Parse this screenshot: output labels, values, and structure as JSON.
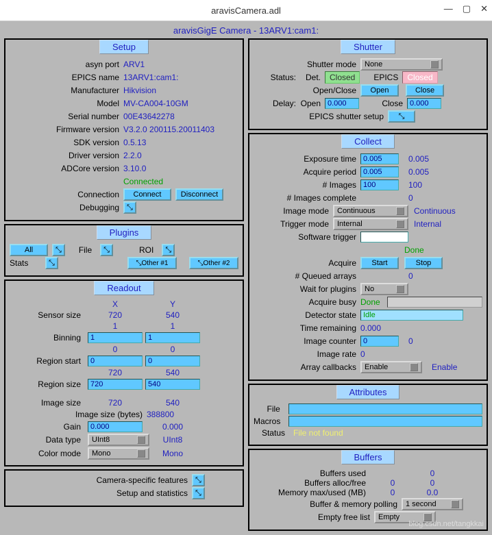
{
  "window": {
    "title": "aravisCamera.adl"
  },
  "subtitle": "aravisGigE Camera - 13ARV1:cam1:",
  "setup": {
    "title": "Setup",
    "asyn_port_lbl": "asyn port",
    "asyn_port": "ARV1",
    "epics_name_lbl": "EPICS name",
    "epics_name": "13ARV1:cam1:",
    "manufacturer_lbl": "Manufacturer",
    "manufacturer": "Hikvision",
    "model_lbl": "Model",
    "model": "MV-CA004-10GM",
    "serial_lbl": "Serial number",
    "serial": "00E43642278",
    "firmware_lbl": "Firmware version",
    "firmware": "V3.2.0 200115.20011403",
    "sdk_lbl": "SDK version",
    "sdk": "0.5.13",
    "driver_lbl": "Driver version",
    "driver": "2.2.0",
    "adcore_lbl": "ADCore version",
    "adcore": "3.10.0",
    "connected": "Connected",
    "connection_lbl": "Connection",
    "connect": "Connect",
    "disconnect": "Disconnect",
    "debugging_lbl": "Debugging",
    "debug_btn": "⤡"
  },
  "plugins": {
    "title": "Plugins",
    "all": "All",
    "all_btn": "⤡",
    "file": "File",
    "file_btn": "⤡",
    "roi": "ROI",
    "roi_btn": "⤡",
    "stats": "Stats",
    "stats_btn": "⤡",
    "other1": "⤡Other #1",
    "other2": "⤡Other #2"
  },
  "readout": {
    "title": "Readout",
    "x_hdr": "X",
    "y_hdr": "Y",
    "sensor_lbl": "Sensor size",
    "sensor_x": "720",
    "sensor_y": "540",
    "one_x": "1",
    "one_y": "1",
    "binning_lbl": "Binning",
    "bin_x": "1",
    "bin_y": "1",
    "zero_x": "0",
    "zero_y": "0",
    "region_start_lbl": "Region start",
    "rs_x": "0",
    "rs_y": "0",
    "rs_rx": "720",
    "rs_ry": "540",
    "region_size_lbl": "Region size",
    "rgs_x": "720",
    "rgs_y": "540",
    "image_size_lbl": "Image size",
    "img_x": "720",
    "img_y": "540",
    "image_bytes_lbl": "Image size (bytes)",
    "image_bytes": "388800",
    "gain_lbl": "Gain",
    "gain_set": "0.000",
    "gain_rbv": "0.000",
    "dtype_lbl": "Data type",
    "dtype_sel": "UInt8",
    "dtype_rbv": "UInt8",
    "cmode_lbl": "Color mode",
    "cmode_sel": "Mono",
    "cmode_rbv": "Mono"
  },
  "camera_features": {
    "label1": "Camera-specific features",
    "btn1": "⤡",
    "label2": "Setup and statistics",
    "btn2": "⤡"
  },
  "shutter": {
    "title": "Shutter",
    "mode_lbl": "Shutter mode",
    "mode": "None",
    "status_lbl": "Status:",
    "det_lbl": "Det.",
    "det_val": "Closed",
    "epics_lbl": "EPICS",
    "epics_val": "Closed",
    "openclose_lbl": "Open/Close",
    "open": "Open",
    "close": "Close",
    "delay_lbl": "Delay:",
    "open_lbl": "Open",
    "open_val": "0.000",
    "close_lbl": "Close",
    "close_val": "0.000",
    "epics_setup_lbl": "EPICS shutter setup",
    "setup_btn": "⤡"
  },
  "collect": {
    "title": "Collect",
    "exposure_lbl": "Exposure time",
    "exposure_set": "0.005",
    "exposure_rbv": "0.005",
    "period_lbl": "Acquire period",
    "period_set": "0.005",
    "period_rbv": "0.005",
    "nimages_lbl": "# Images",
    "nimages_set": "100",
    "nimages_rbv": "100",
    "ncomplete_lbl": "# Images complete",
    "ncomplete": "0",
    "imgmode_lbl": "Image mode",
    "imgmode_sel": "Continuous",
    "imgmode_rbv": "Continuous",
    "trigmode_lbl": "Trigger mode",
    "trigmode_sel": "Internal",
    "trigmode_rbv": "Internal",
    "swtrig_lbl": "Software trigger",
    "done": "Done",
    "acquire_lbl": "Acquire",
    "start": "Start",
    "stop": "Stop",
    "queued_lbl": "# Queued arrays",
    "queued": "0",
    "wait_lbl": "Wait for plugins",
    "wait_sel": "No",
    "busy_lbl": "Acquire busy",
    "busy": "Done",
    "dstate_lbl": "Detector state",
    "dstate": "Idle",
    "tremain_lbl": "Time remaining",
    "tremain": "0.000",
    "counter_lbl": "Image counter",
    "counter_set": "0",
    "counter_rbv": "0",
    "rate_lbl": "Image rate",
    "rate": "0",
    "callbacks_lbl": "Array callbacks",
    "callbacks_sel": "Enable",
    "callbacks_rbv": "Enable"
  },
  "attributes": {
    "title": "Attributes",
    "file_lbl": "File",
    "file_val": "",
    "macros_lbl": "Macros",
    "macros_val": "",
    "status_lbl": "Status",
    "status_val": "File not found"
  },
  "buffers": {
    "title": "Buffers",
    "used_lbl": "Buffers used",
    "used": "0",
    "alloc_lbl": "Buffers alloc/free",
    "alloc": "0",
    "free": "0",
    "mem_lbl": "Memory max/used (MB)",
    "mem_max": "0",
    "mem_used": "0.0",
    "poll_lbl": "Buffer & memory polling",
    "poll_sel": "1 second",
    "empty_lbl": "Empty free list",
    "empty_sel": "Empty"
  },
  "watermark": "blog.csdn.net/tangkkai"
}
